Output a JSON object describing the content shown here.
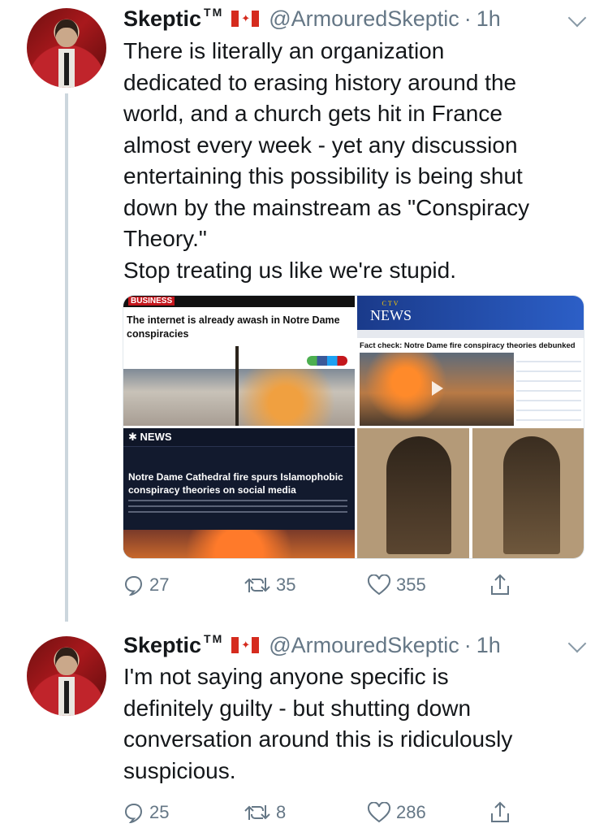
{
  "tweets": [
    {
      "name": "Skeptic",
      "name_suffix": "TM",
      "handle": "@ArmouredSkeptic",
      "separator": "·",
      "time": "1h",
      "text": "There is literally an organization\ndedicated to erasing history around the\nworld, and a church gets hit in France\nalmost every week - yet any discussion\nentertaining this possibility is being shut\ndown by the mainstream as \"Conspiracy\nTheory.\"\nStop treating us like we're stupid.",
      "media": {
        "business": {
          "logo": "BUSINESS",
          "headline": "The internet is already awash in Notre Dame conspiracies"
        },
        "ctv": {
          "logo": "NEWS",
          "logo_top": "CTV",
          "headline": "Fact check: Notre Dame fire conspiracy theories debunked"
        },
        "nbc": {
          "logo": "NEWS",
          "headline": "Notre Dame Cathedral fire spurs Islamophobic conspiracy theories on social media"
        }
      },
      "actions": {
        "replies": "27",
        "retweets": "35",
        "likes": "355"
      }
    },
    {
      "name": "Skeptic",
      "name_suffix": "TM",
      "handle": "@ArmouredSkeptic",
      "separator": "·",
      "time": "1h",
      "text": "I'm not saying anyone specific is\ndefinitely guilty - but shutting down\nconversation around this is ridiculously\nsuspicious.",
      "actions": {
        "replies": "25",
        "retweets": "8",
        "likes": "286"
      }
    }
  ],
  "icons": {
    "flag": "canada-flag-icon",
    "reply": "reply-icon",
    "retweet": "retweet-icon",
    "like": "heart-icon",
    "share": "share-icon",
    "menu": "chevron-down-icon"
  },
  "colors": {
    "text": "#14171a",
    "secondary": "#657786",
    "thread": "#ccd6dd",
    "flag_red": "#d52b1e"
  }
}
